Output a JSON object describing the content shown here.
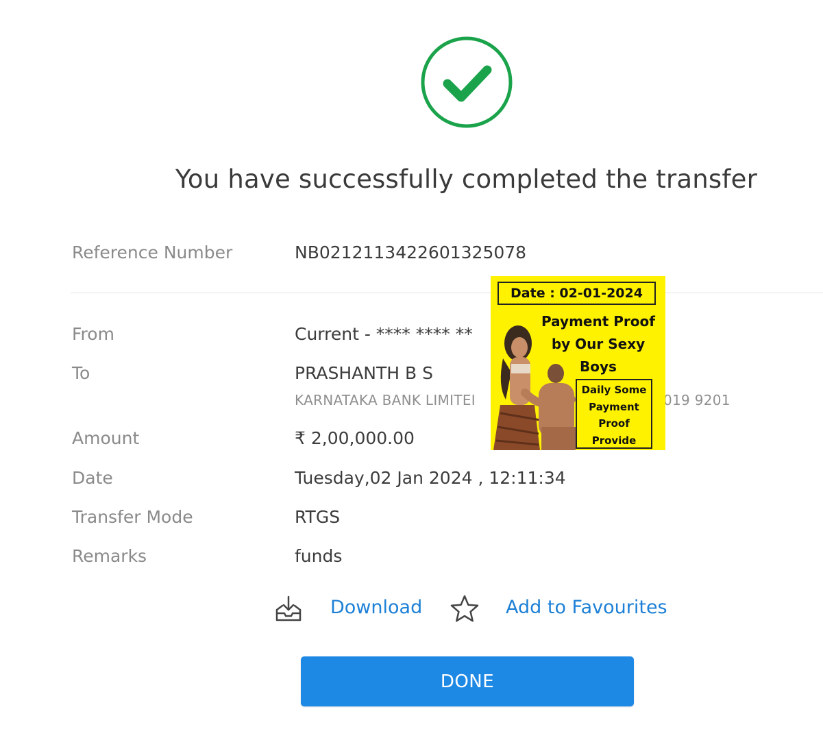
{
  "status": {
    "icon": "check-circle-icon",
    "headline": "You have successfully completed the transfer",
    "accent_color": "#1aa34a"
  },
  "reference": {
    "label": "Reference Number",
    "value": "NB0212113422601325078"
  },
  "details": {
    "from_label": "From",
    "from_value": "Current - **** **** **",
    "to_label": "To",
    "to_value": "PRASHANTH B S",
    "to_bank": "KARNATAKA BANK LIMITEI",
    "to_account_tail": "019 9201",
    "amount_label": "Amount",
    "amount_value": "₹ 2,00,000.00",
    "date_label": "Date",
    "date_value": "Tuesday,02 Jan 2024 , 12:11:34",
    "mode_label": "Transfer Mode",
    "mode_value": "RTGS",
    "remarks_label": "Remarks",
    "remarks_value": "funds"
  },
  "actions": {
    "download_label": "Download",
    "download_icon": "download-tray-icon",
    "favourite_label": "Add to Favourites",
    "favourite_icon": "star-outline-icon",
    "link_color": "#1d80d6"
  },
  "done_button": {
    "label": "DONE",
    "color": "#1e88e5"
  },
  "overlay": {
    "date": "Date : 02-01-2024",
    "title_line1": "Payment Proof",
    "title_line2": "by Our Sexy",
    "title_line3": "Boys",
    "box_line1": "Daily Some",
    "box_line2": "Payment",
    "box_line3": "Proof",
    "box_line4": "Provide",
    "background": "#fff200"
  }
}
